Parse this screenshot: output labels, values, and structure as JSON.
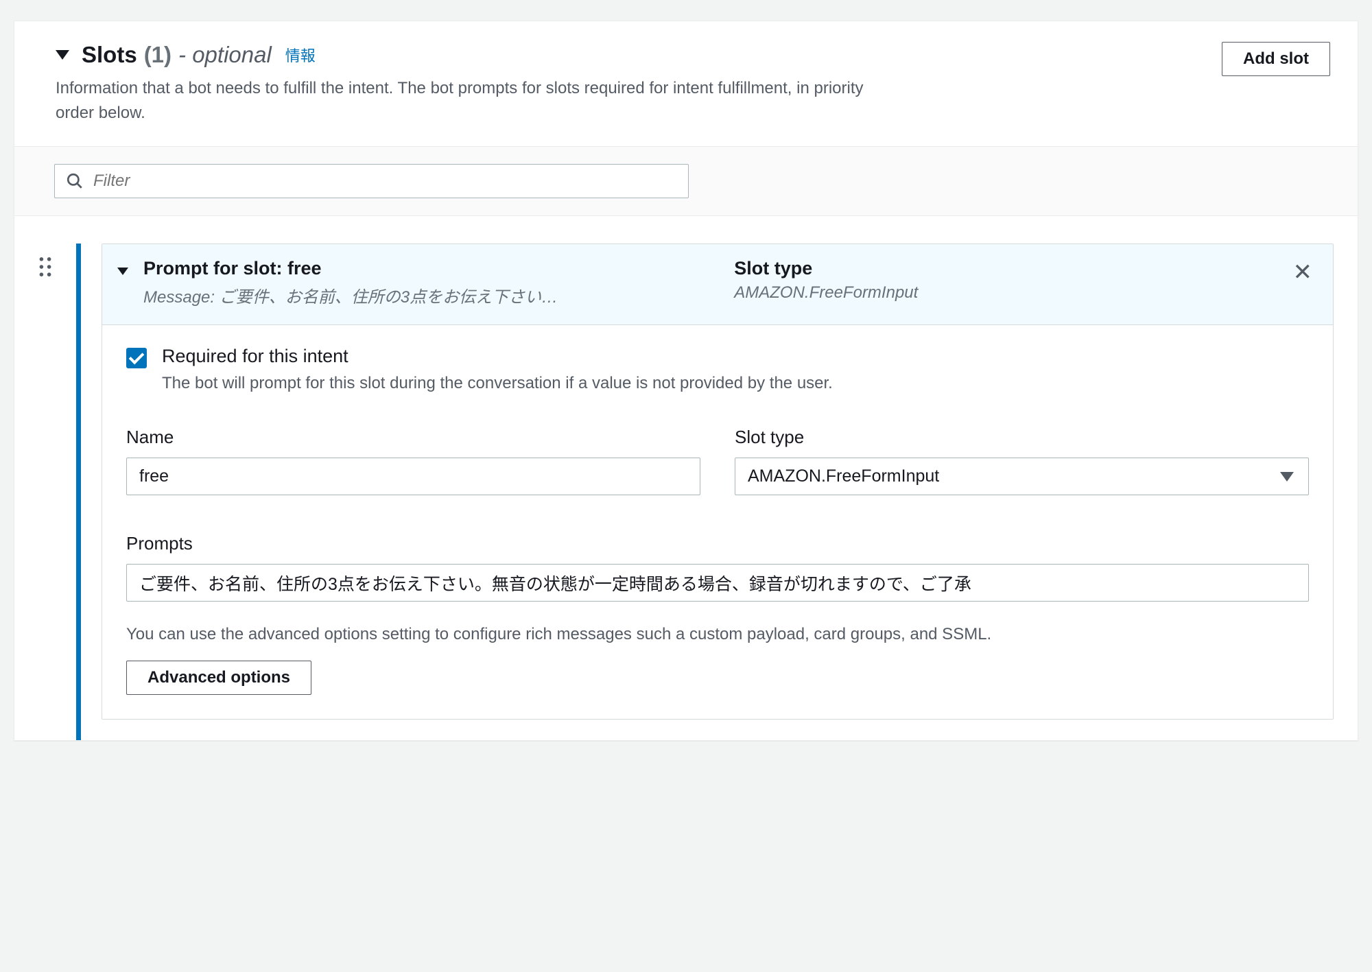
{
  "section": {
    "title": "Slots",
    "count": "(1)",
    "optional_label": "- optional",
    "info_label": "情報",
    "description": "Information that a bot needs to fulfill the intent. The bot prompts for slots required for intent fulfillment, in priority order below.",
    "add_button": "Add slot"
  },
  "filter": {
    "placeholder": "Filter"
  },
  "slot": {
    "header_title": "Prompt for slot: free",
    "header_message_prefix": "Message: ",
    "header_message": "ご要件、お名前、住所の3点をお伝え下さい…",
    "type_label": "Slot type",
    "type_value": "AMAZON.FreeFormInput",
    "required_label": "Required for this intent",
    "required_desc": "The bot will prompt for this slot during the conversation if a value is not provided by the user.",
    "name_label": "Name",
    "name_value": "free",
    "slot_type_field_label": "Slot type",
    "slot_type_field_value": "AMAZON.FreeFormInput",
    "prompts_label": "Prompts",
    "prompts_value": "ご要件、お名前、住所の3点をお伝え下さい。無音の状態が一定時間ある場合、録音が切れますので、ご了承",
    "adv_helper": "You can use the advanced options setting to configure rich messages such a custom payload, card groups, and SSML.",
    "adv_button": "Advanced options"
  }
}
